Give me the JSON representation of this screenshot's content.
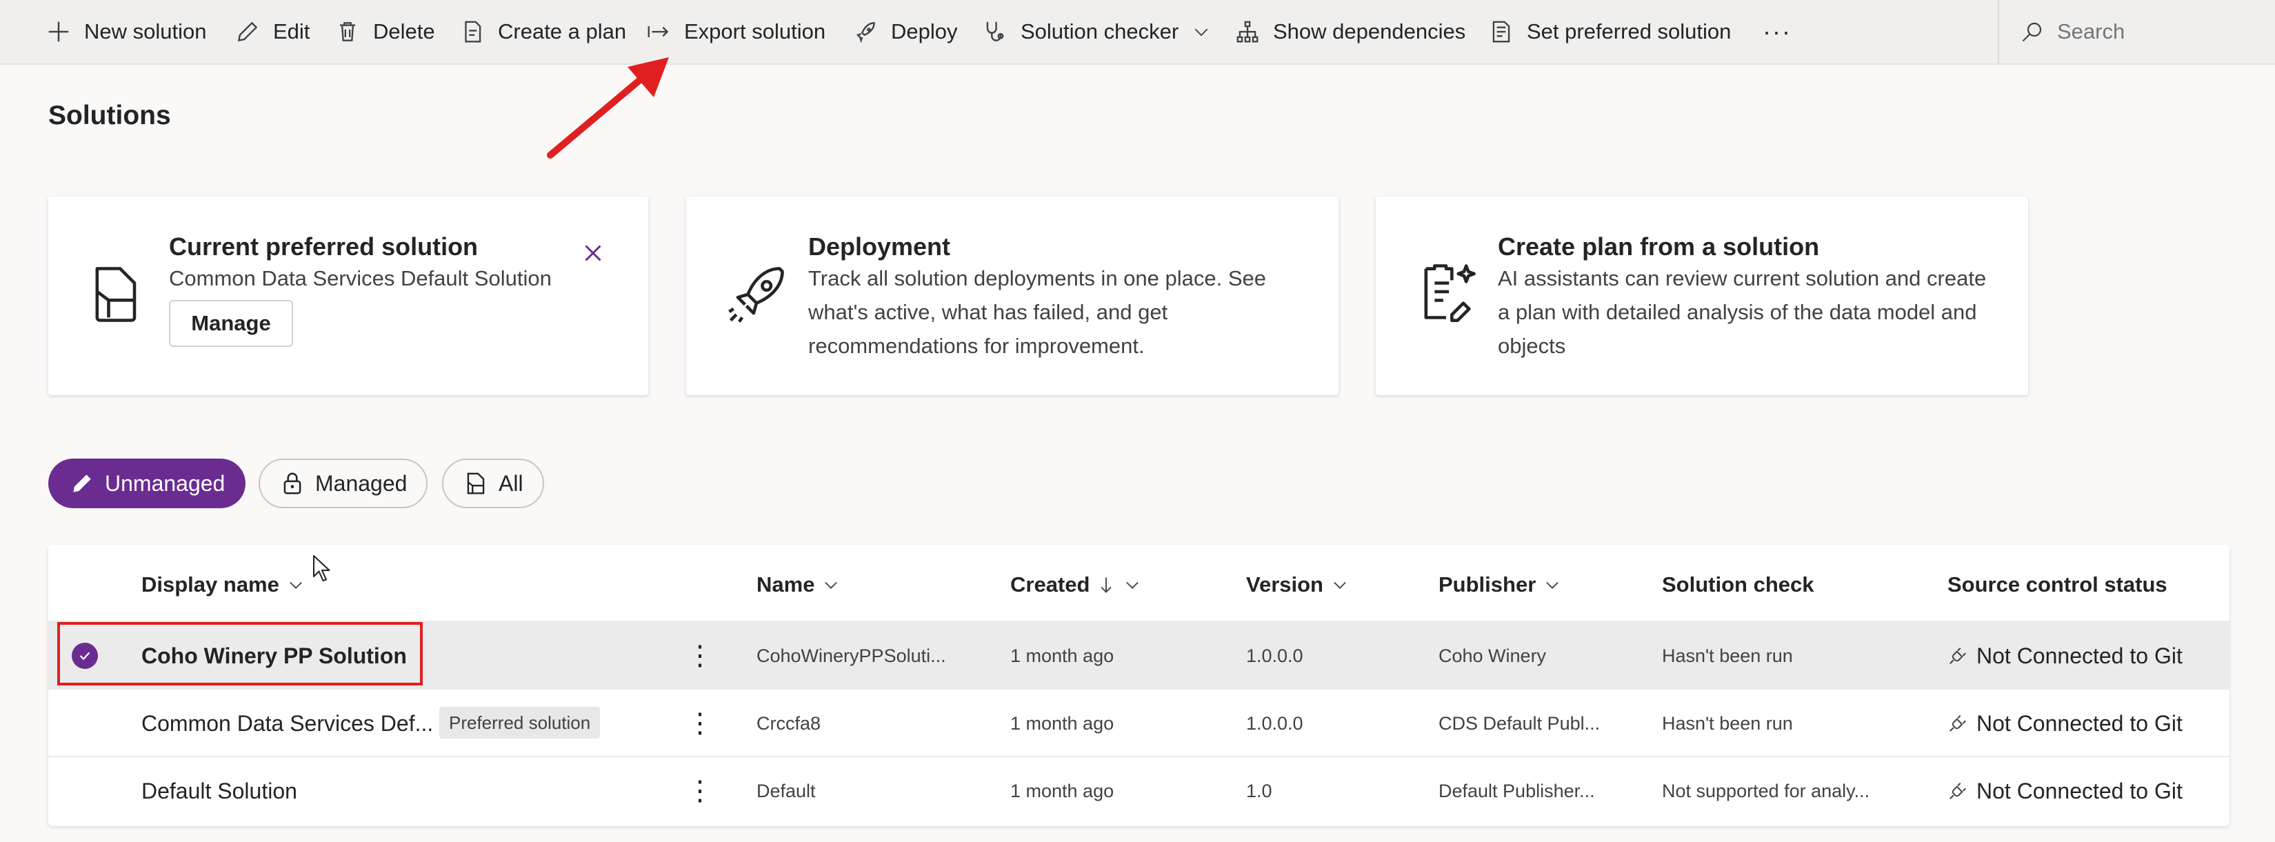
{
  "commandbar": {
    "items": [
      {
        "label": "New solution",
        "icon": "plus-icon"
      },
      {
        "label": "Edit",
        "icon": "pencil-icon"
      },
      {
        "label": "Delete",
        "icon": "trash-icon"
      },
      {
        "label": "Create a plan",
        "icon": "plan-icon"
      },
      {
        "label": "Export solution",
        "icon": "export-arrow-icon"
      },
      {
        "label": "Deploy",
        "icon": "rocket-icon"
      },
      {
        "label": "Solution checker",
        "icon": "stethoscope-icon"
      },
      {
        "label": "Show dependencies",
        "icon": "hierarchy-icon"
      },
      {
        "label": "Set preferred solution",
        "icon": "preferred-icon"
      }
    ],
    "more": "···",
    "search_placeholder": "Search"
  },
  "page": {
    "title": "Solutions"
  },
  "cards": {
    "preferred": {
      "title": "Current preferred solution",
      "text": "Common Data Services Default Solution",
      "button": "Manage"
    },
    "deployment": {
      "title": "Deployment",
      "text": "Track all solution deployments in one place. See what's active, what has failed, and get recommendations for improvement."
    },
    "plan": {
      "title": "Create plan from a solution",
      "text": "AI assistants can review current solution and create a plan with detailed analysis of the data model and objects"
    }
  },
  "filters": {
    "unmanaged": "Unmanaged",
    "managed": "Managed",
    "all": "All",
    "active": "Unmanaged"
  },
  "table": {
    "headers": {
      "display_name": "Display name",
      "name": "Name",
      "created": "Created",
      "version": "Version",
      "publisher": "Publisher",
      "solution_check": "Solution check",
      "source_control": "Source control status"
    },
    "rows": [
      {
        "display_name": "Coho Winery PP Solution",
        "name": "CohoWineryPPSoluti...",
        "created": "1 month ago",
        "version": "1.0.0.0",
        "publisher": "Coho Winery",
        "solution_check": "Hasn't been run",
        "source_control": "Not Connected to Git",
        "badge": "",
        "selected": true
      },
      {
        "display_name": "Common Data Services Def...",
        "name": "Crccfa8",
        "created": "1 month ago",
        "version": "1.0.0.0",
        "publisher": "CDS Default Publ...",
        "solution_check": "Hasn't been run",
        "source_control": "Not Connected to Git",
        "badge": "Preferred solution",
        "selected": false
      },
      {
        "display_name": "Default Solution",
        "name": "Default",
        "created": "1 month ago",
        "version": "1.0",
        "publisher": "Default Publisher...",
        "solution_check": "Not supported for analy...",
        "source_control": "Not Connected to Git",
        "badge": "",
        "selected": false
      }
    ]
  },
  "colors": {
    "accent": "#6b2c91",
    "annotation": "#e02020"
  }
}
